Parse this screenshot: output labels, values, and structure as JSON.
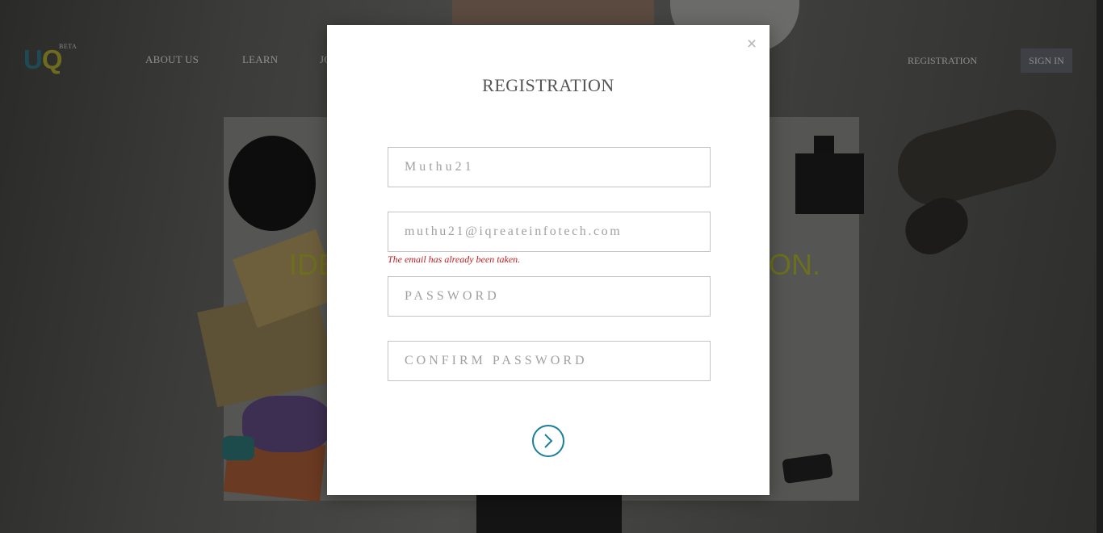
{
  "header": {
    "logo_u": "U",
    "logo_q": "Q",
    "beta": "BETA",
    "nav": [
      "ABOUT US",
      "LEARN",
      "JO"
    ],
    "registration": "REGISTRATION",
    "sign_in": "SIGN IN"
  },
  "hero": {
    "left": "IDE",
    "right": "ON."
  },
  "modal": {
    "close": "×",
    "title": "REGISTRATION",
    "username_value": "Muthu21",
    "email_value": "muthu21@iqreateinfotech.com",
    "email_error": "The email has already been taken.",
    "password_placeholder": "PASSWORD",
    "confirm_placeholder": "CONFIRM PASSWORD",
    "submit_icon": "chevron-right-icon"
  },
  "colors": {
    "accent": "#1a7e9c",
    "error": "#c4181c",
    "logo_u": "#1e4a55",
    "logo_q": "#6e6a1e"
  }
}
